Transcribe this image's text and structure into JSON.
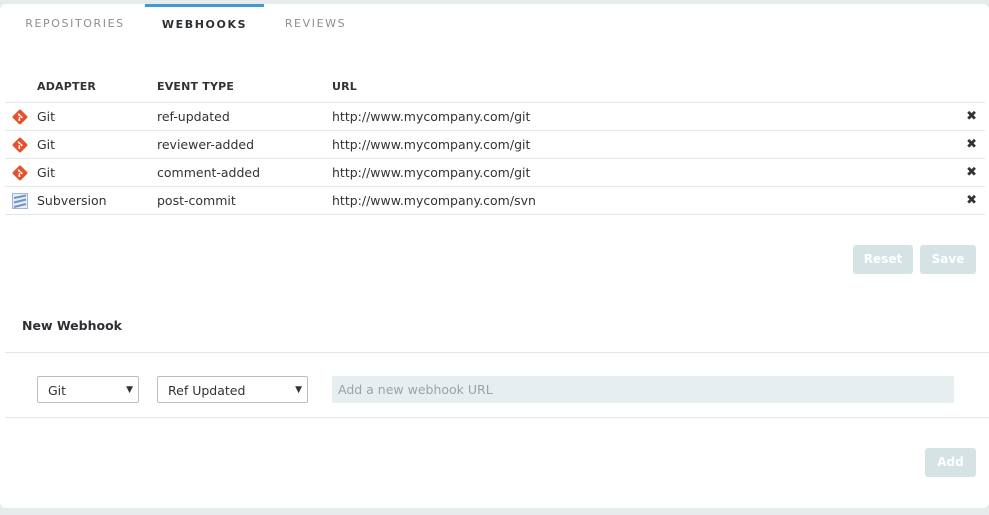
{
  "tabs": [
    {
      "label": "REPOSITORIES",
      "active": false
    },
    {
      "label": "WEBHOOKS",
      "active": true
    },
    {
      "label": "REVIEWS",
      "active": false
    }
  ],
  "table": {
    "headers": {
      "adapter": "ADAPTER",
      "event_type": "EVENT TYPE",
      "url": "URL"
    },
    "rows": [
      {
        "adapter": "Git",
        "adapter_icon": "git-icon",
        "event_type": "ref-updated",
        "url": "http://www.mycompany.com/git"
      },
      {
        "adapter": "Git",
        "adapter_icon": "git-icon",
        "event_type": "reviewer-added",
        "url": "http://www.mycompany.com/git"
      },
      {
        "adapter": "Git",
        "adapter_icon": "git-icon",
        "event_type": "comment-added",
        "url": "http://www.mycompany.com/git"
      },
      {
        "adapter": "Subversion",
        "adapter_icon": "subversion-icon",
        "event_type": "post-commit",
        "url": "http://www.mycompany.com/svn"
      }
    ],
    "remove_glyph": "✖"
  },
  "actions": {
    "reset_label": "Reset",
    "save_label": "Save"
  },
  "new_webhook": {
    "title": "New Webhook",
    "adapter_selected": "Git",
    "event_selected": "Ref Updated",
    "url_placeholder": "Add a new webhook URL",
    "url_value": "",
    "add_label": "Add"
  },
  "colors": {
    "accent": "#3e9bd3",
    "git": "#e4512f",
    "subversion": "#7a9cc8",
    "disabled_button": "#d5e3e4"
  }
}
